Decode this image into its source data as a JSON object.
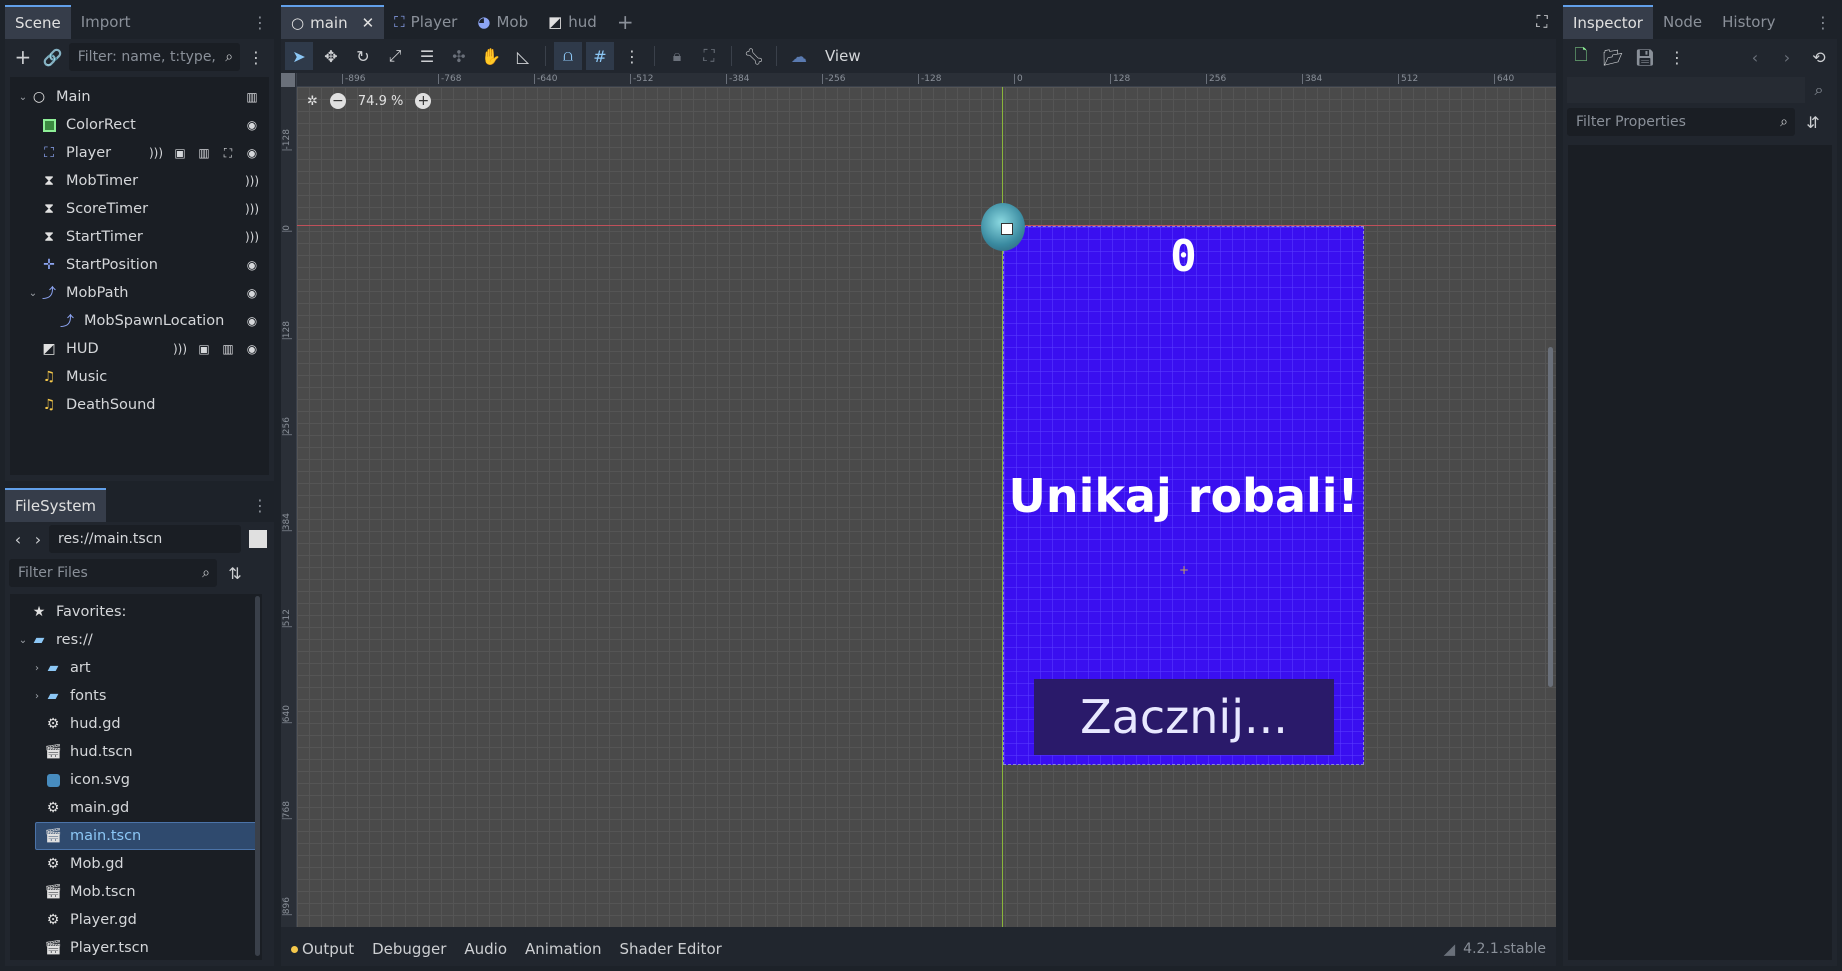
{
  "scene_dock": {
    "tabs": [
      "Scene",
      "Import"
    ],
    "filter_placeholder": "Filter: name, t:type,",
    "nodes": [
      {
        "name": "Main"
      },
      {
        "name": "ColorRect"
      },
      {
        "name": "Player"
      },
      {
        "name": "MobTimer"
      },
      {
        "name": "ScoreTimer"
      },
      {
        "name": "StartTimer"
      },
      {
        "name": "StartPosition"
      },
      {
        "name": "MobPath"
      },
      {
        "name": "MobSpawnLocation"
      },
      {
        "name": "HUD"
      },
      {
        "name": "Music"
      },
      {
        "name": "DeathSound"
      }
    ]
  },
  "filesystem": {
    "tab": "FileSystem",
    "path": "res://main.tscn",
    "filter_placeholder": "Filter Files",
    "items": [
      {
        "label": "Favorites:"
      },
      {
        "label": "res://"
      },
      {
        "label": "art"
      },
      {
        "label": "fonts"
      },
      {
        "label": "hud.gd"
      },
      {
        "label": "hud.tscn"
      },
      {
        "label": "icon.svg"
      },
      {
        "label": "main.gd"
      },
      {
        "label": "main.tscn"
      },
      {
        "label": "Mob.gd"
      },
      {
        "label": "Mob.tscn"
      },
      {
        "label": "Player.gd"
      },
      {
        "label": "Player.tscn"
      }
    ]
  },
  "editor_tabs": [
    "main",
    "Player",
    "Mob",
    "hud"
  ],
  "toolbar": {
    "view_label": "View"
  },
  "zoom": {
    "value": "74.9 %"
  },
  "rulers": {
    "top": [
      "-896",
      "-768",
      "-640",
      "-512",
      "-384",
      "-256",
      "-128",
      "0",
      "128",
      "256",
      "384",
      "512",
      "640"
    ],
    "left": [
      "-128",
      "0",
      "128",
      "256",
      "384",
      "512",
      "640",
      "768",
      "896"
    ]
  },
  "game": {
    "score": "0",
    "message": "Unikaj robali!",
    "start_button": "Zacznij..."
  },
  "bottom_panel": {
    "buttons": [
      "Output",
      "Debugger",
      "Audio",
      "Animation",
      "Shader Editor"
    ],
    "version": "4.2.1.stable"
  },
  "inspector": {
    "tabs": [
      "Inspector",
      "Node",
      "History"
    ],
    "filter_placeholder": "Filter Properties"
  },
  "colors": {
    "accent": "#62a0ea",
    "game_bg": "#3a0ff0",
    "start_button_bg": "#2a1a6a"
  }
}
